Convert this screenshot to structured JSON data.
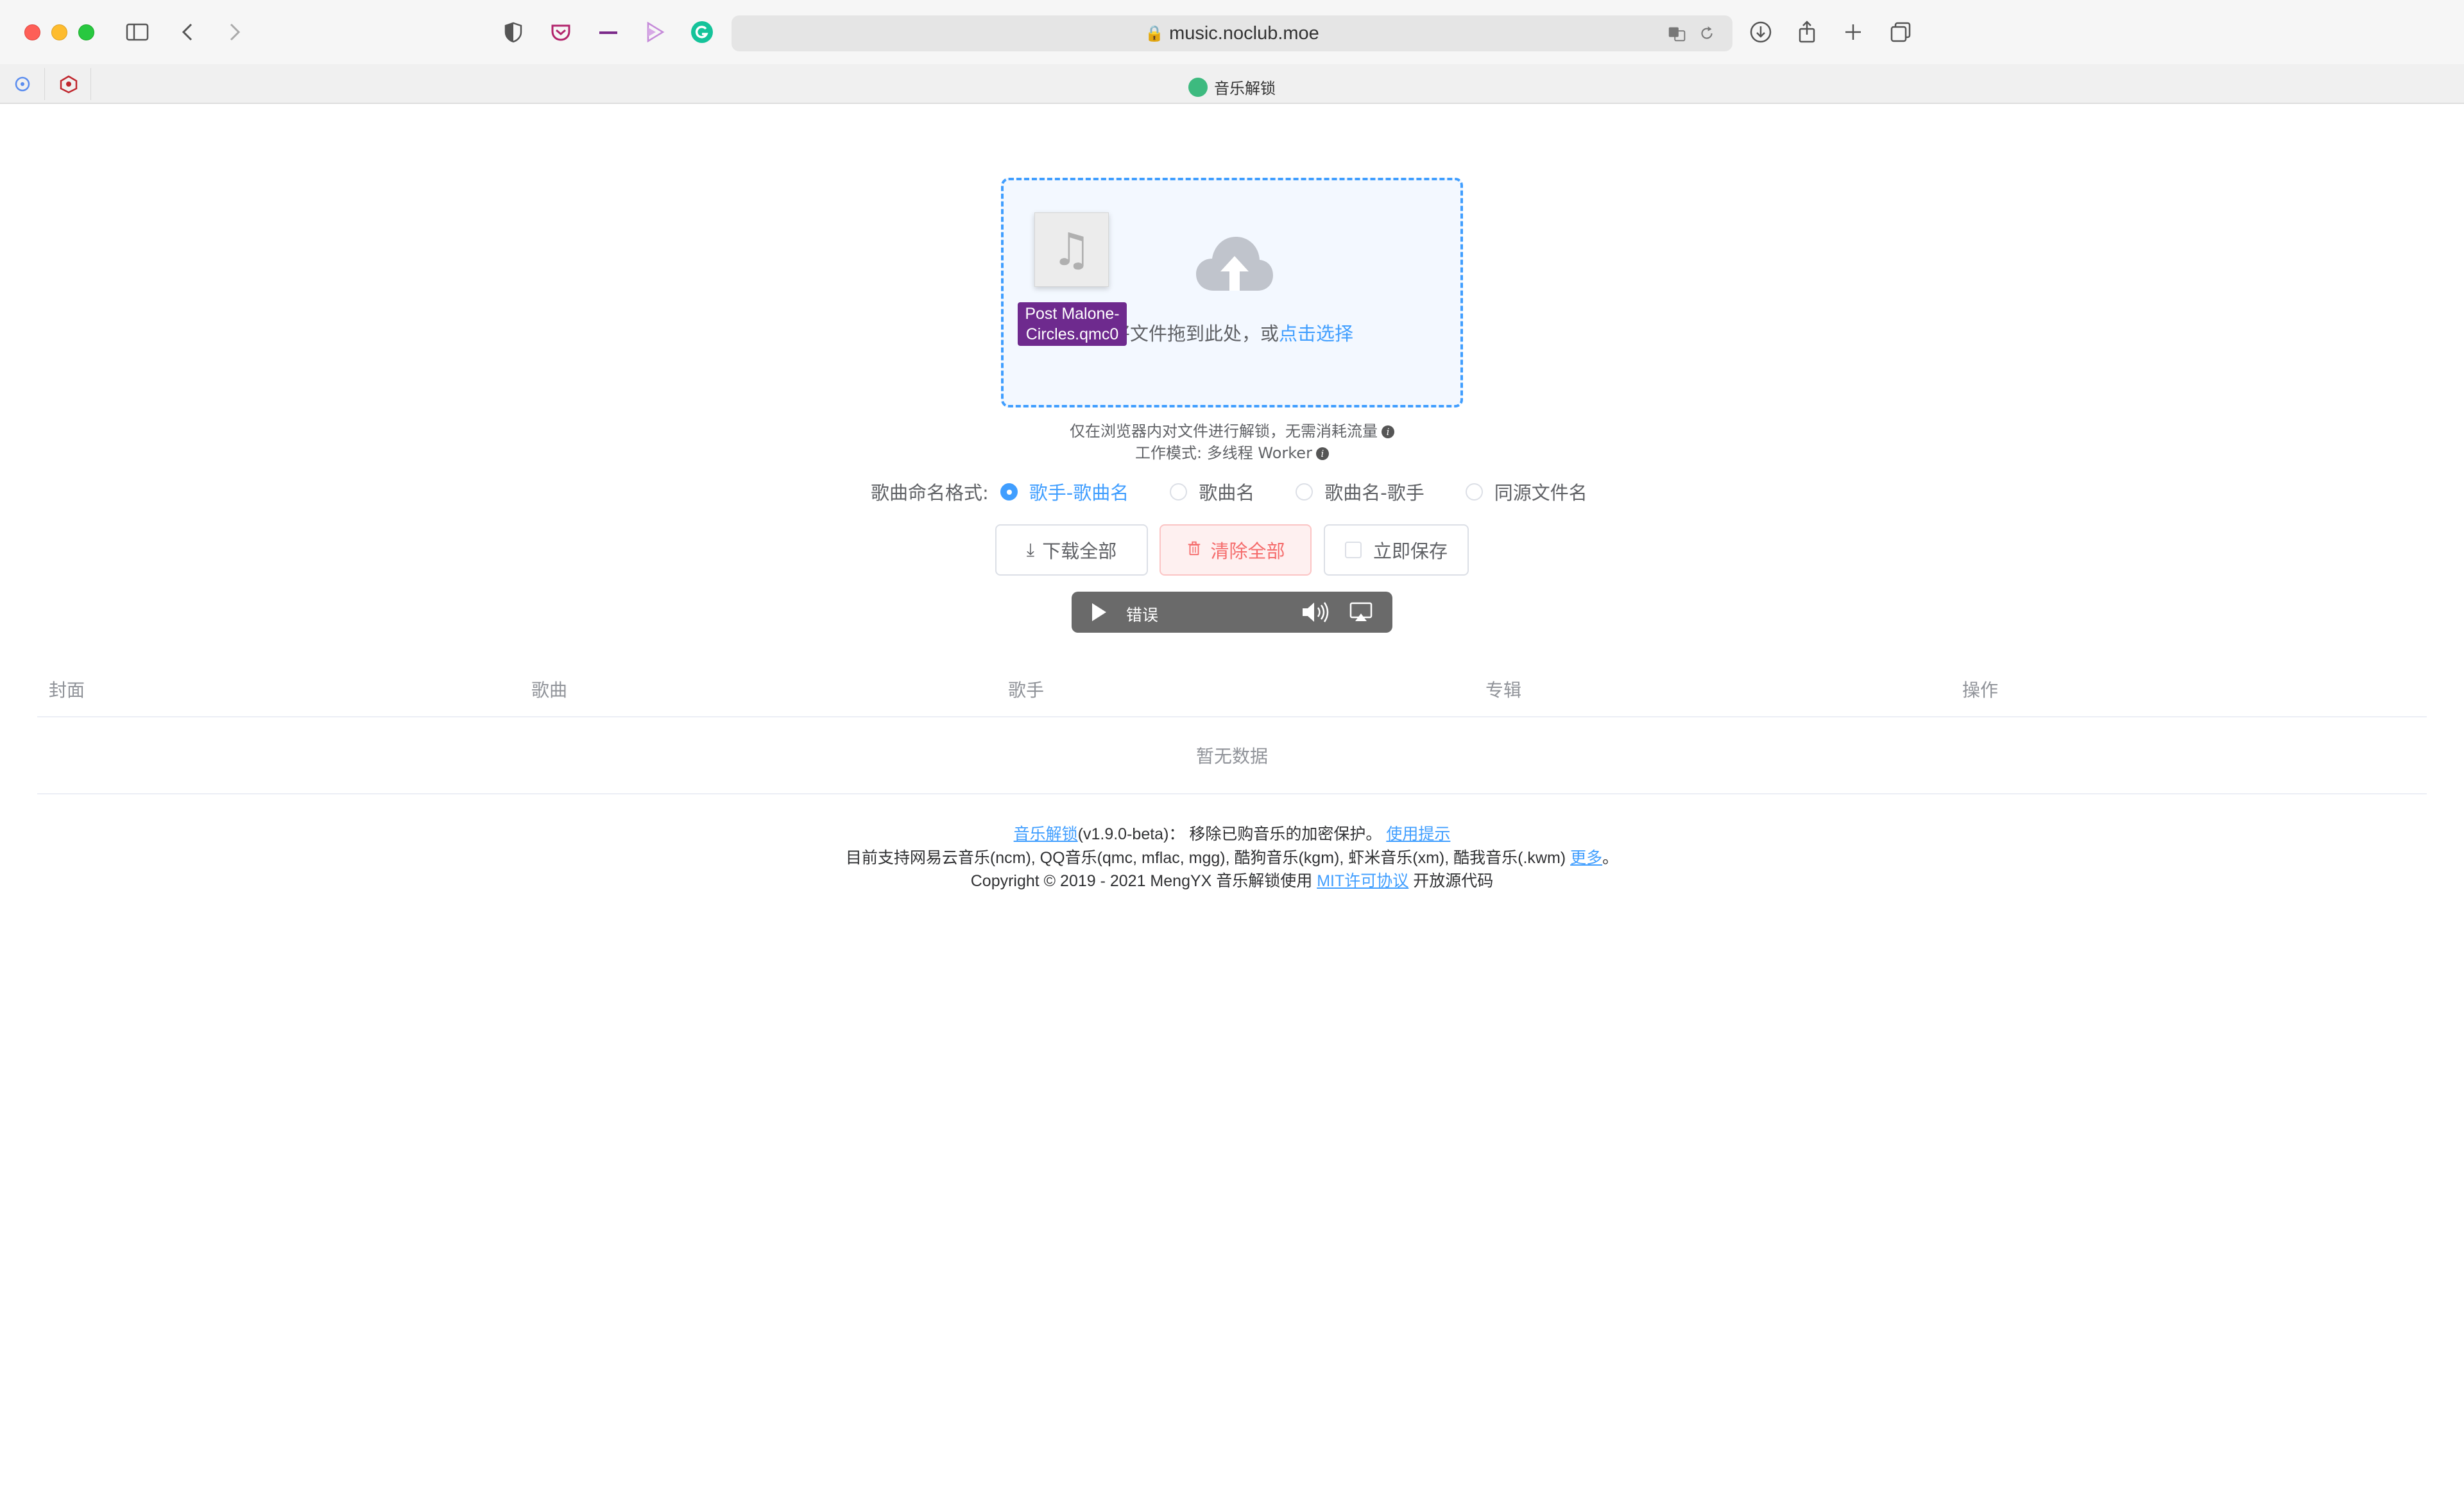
{
  "browser": {
    "url": "music.noclub.moe",
    "tab_title": "音乐解锁"
  },
  "upload": {
    "text_prefix": "将文件拖到此处，或",
    "text_link": "点击选择",
    "dragging_file": "Post Malone-Circles.qmc0"
  },
  "tips": {
    "line1": "仅在浏览器内对文件进行解锁，无需消耗流量",
    "line2": "工作模式: 多线程 Worker"
  },
  "naming": {
    "label": "歌曲命名格式:",
    "options": [
      "歌手-歌曲名",
      "歌曲名",
      "歌曲名-歌手",
      "同源文件名"
    ],
    "selected": "歌手-歌曲名"
  },
  "buttons": {
    "download_all": "下载全部",
    "clear_all": "清除全部",
    "save_now": "立即保存"
  },
  "player": {
    "status": "错误"
  },
  "table": {
    "columns": [
      "封面",
      "歌曲",
      "歌手",
      "专辑",
      "操作"
    ],
    "empty_text": "暂无数据"
  },
  "footer": {
    "line1_link": "音乐解锁",
    "line1_version": "(v1.9.0-beta)：",
    "line1_text": "移除已购音乐的加密保护。",
    "line1_tips_link": "使用提示",
    "line2_text": "目前支持网易云音乐(ncm), QQ音乐(qmc, mflac, mgg), 酷狗音乐(kgm), 虾米音乐(xm), 酷我音乐(.kwm)",
    "line2_more_link": "更多",
    "line2_end": "。",
    "line3_text": "Copyright © 2019 - 2021 MengYX 音乐解锁使用",
    "line3_license_link": "MIT许可协议",
    "line3_end": "开放源代码"
  },
  "colors": {
    "accent": "#409eff",
    "danger": "#f56c6c",
    "drag_label_bg": "#6e2a8e"
  }
}
